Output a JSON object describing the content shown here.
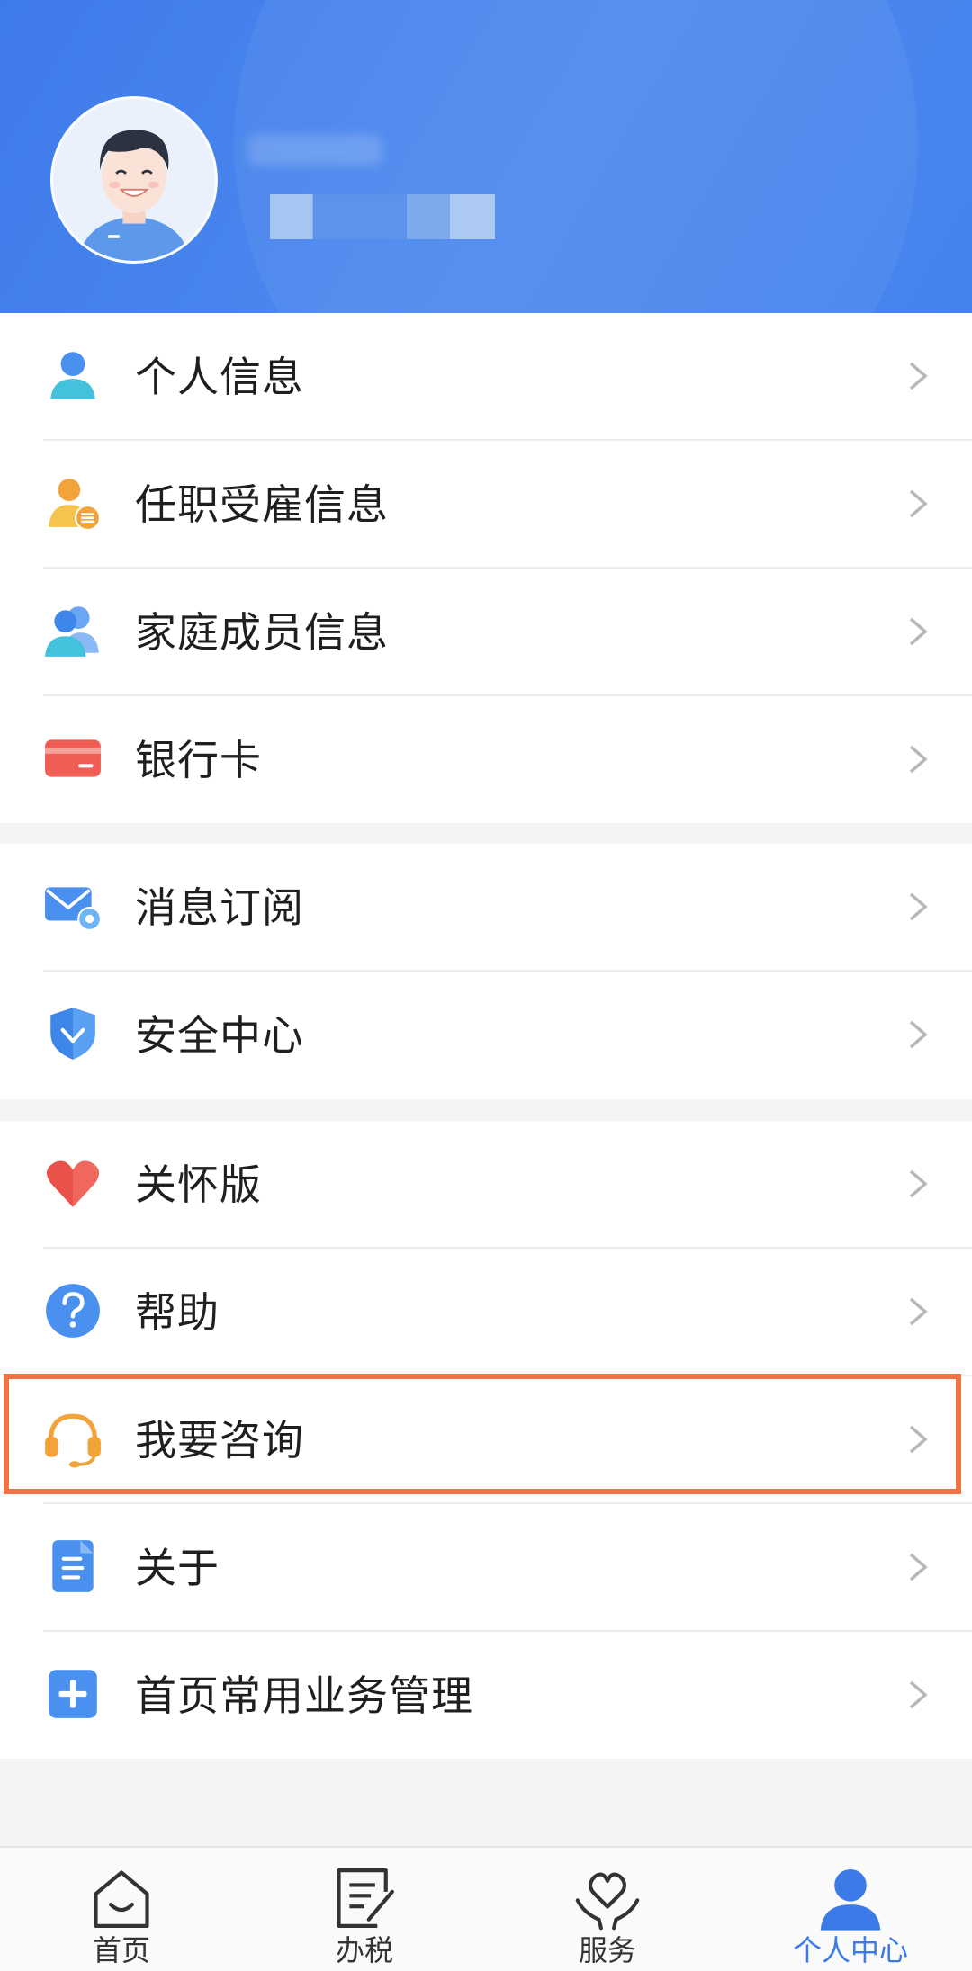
{
  "profile": {
    "avatar_icon": "user-avatar-icon",
    "name": "",
    "id": ""
  },
  "menu": {
    "group1": [
      {
        "label": "个人信息",
        "icon": "person-icon"
      },
      {
        "label": "任职受雇信息",
        "icon": "employment-icon"
      },
      {
        "label": "家庭成员信息",
        "icon": "family-icon"
      },
      {
        "label": "银行卡",
        "icon": "bank-card-icon"
      }
    ],
    "group2": [
      {
        "label": "消息订阅",
        "icon": "mail-settings-icon"
      },
      {
        "label": "安全中心",
        "icon": "shield-icon"
      }
    ],
    "group3": [
      {
        "label": "关怀版",
        "icon": "heart-icon"
      },
      {
        "label": "帮助",
        "icon": "help-icon"
      },
      {
        "label": "我要咨询",
        "icon": "headset-icon"
      },
      {
        "label": "关于",
        "icon": "document-icon"
      },
      {
        "label": "首页常用业务管理",
        "icon": "plus-square-icon"
      }
    ]
  },
  "tabbar": {
    "tabs": [
      {
        "label": "首页",
        "icon": "home-icon"
      },
      {
        "label": "办税",
        "icon": "tax-edit-icon"
      },
      {
        "label": "服务",
        "icon": "service-heart-icon"
      },
      {
        "label": "个人中心",
        "icon": "person-center-icon"
      }
    ],
    "active_index": 3
  },
  "colors": {
    "header_blue": "#4483ee",
    "active_tab": "#3c7ae8",
    "highlight": "#f07343"
  }
}
